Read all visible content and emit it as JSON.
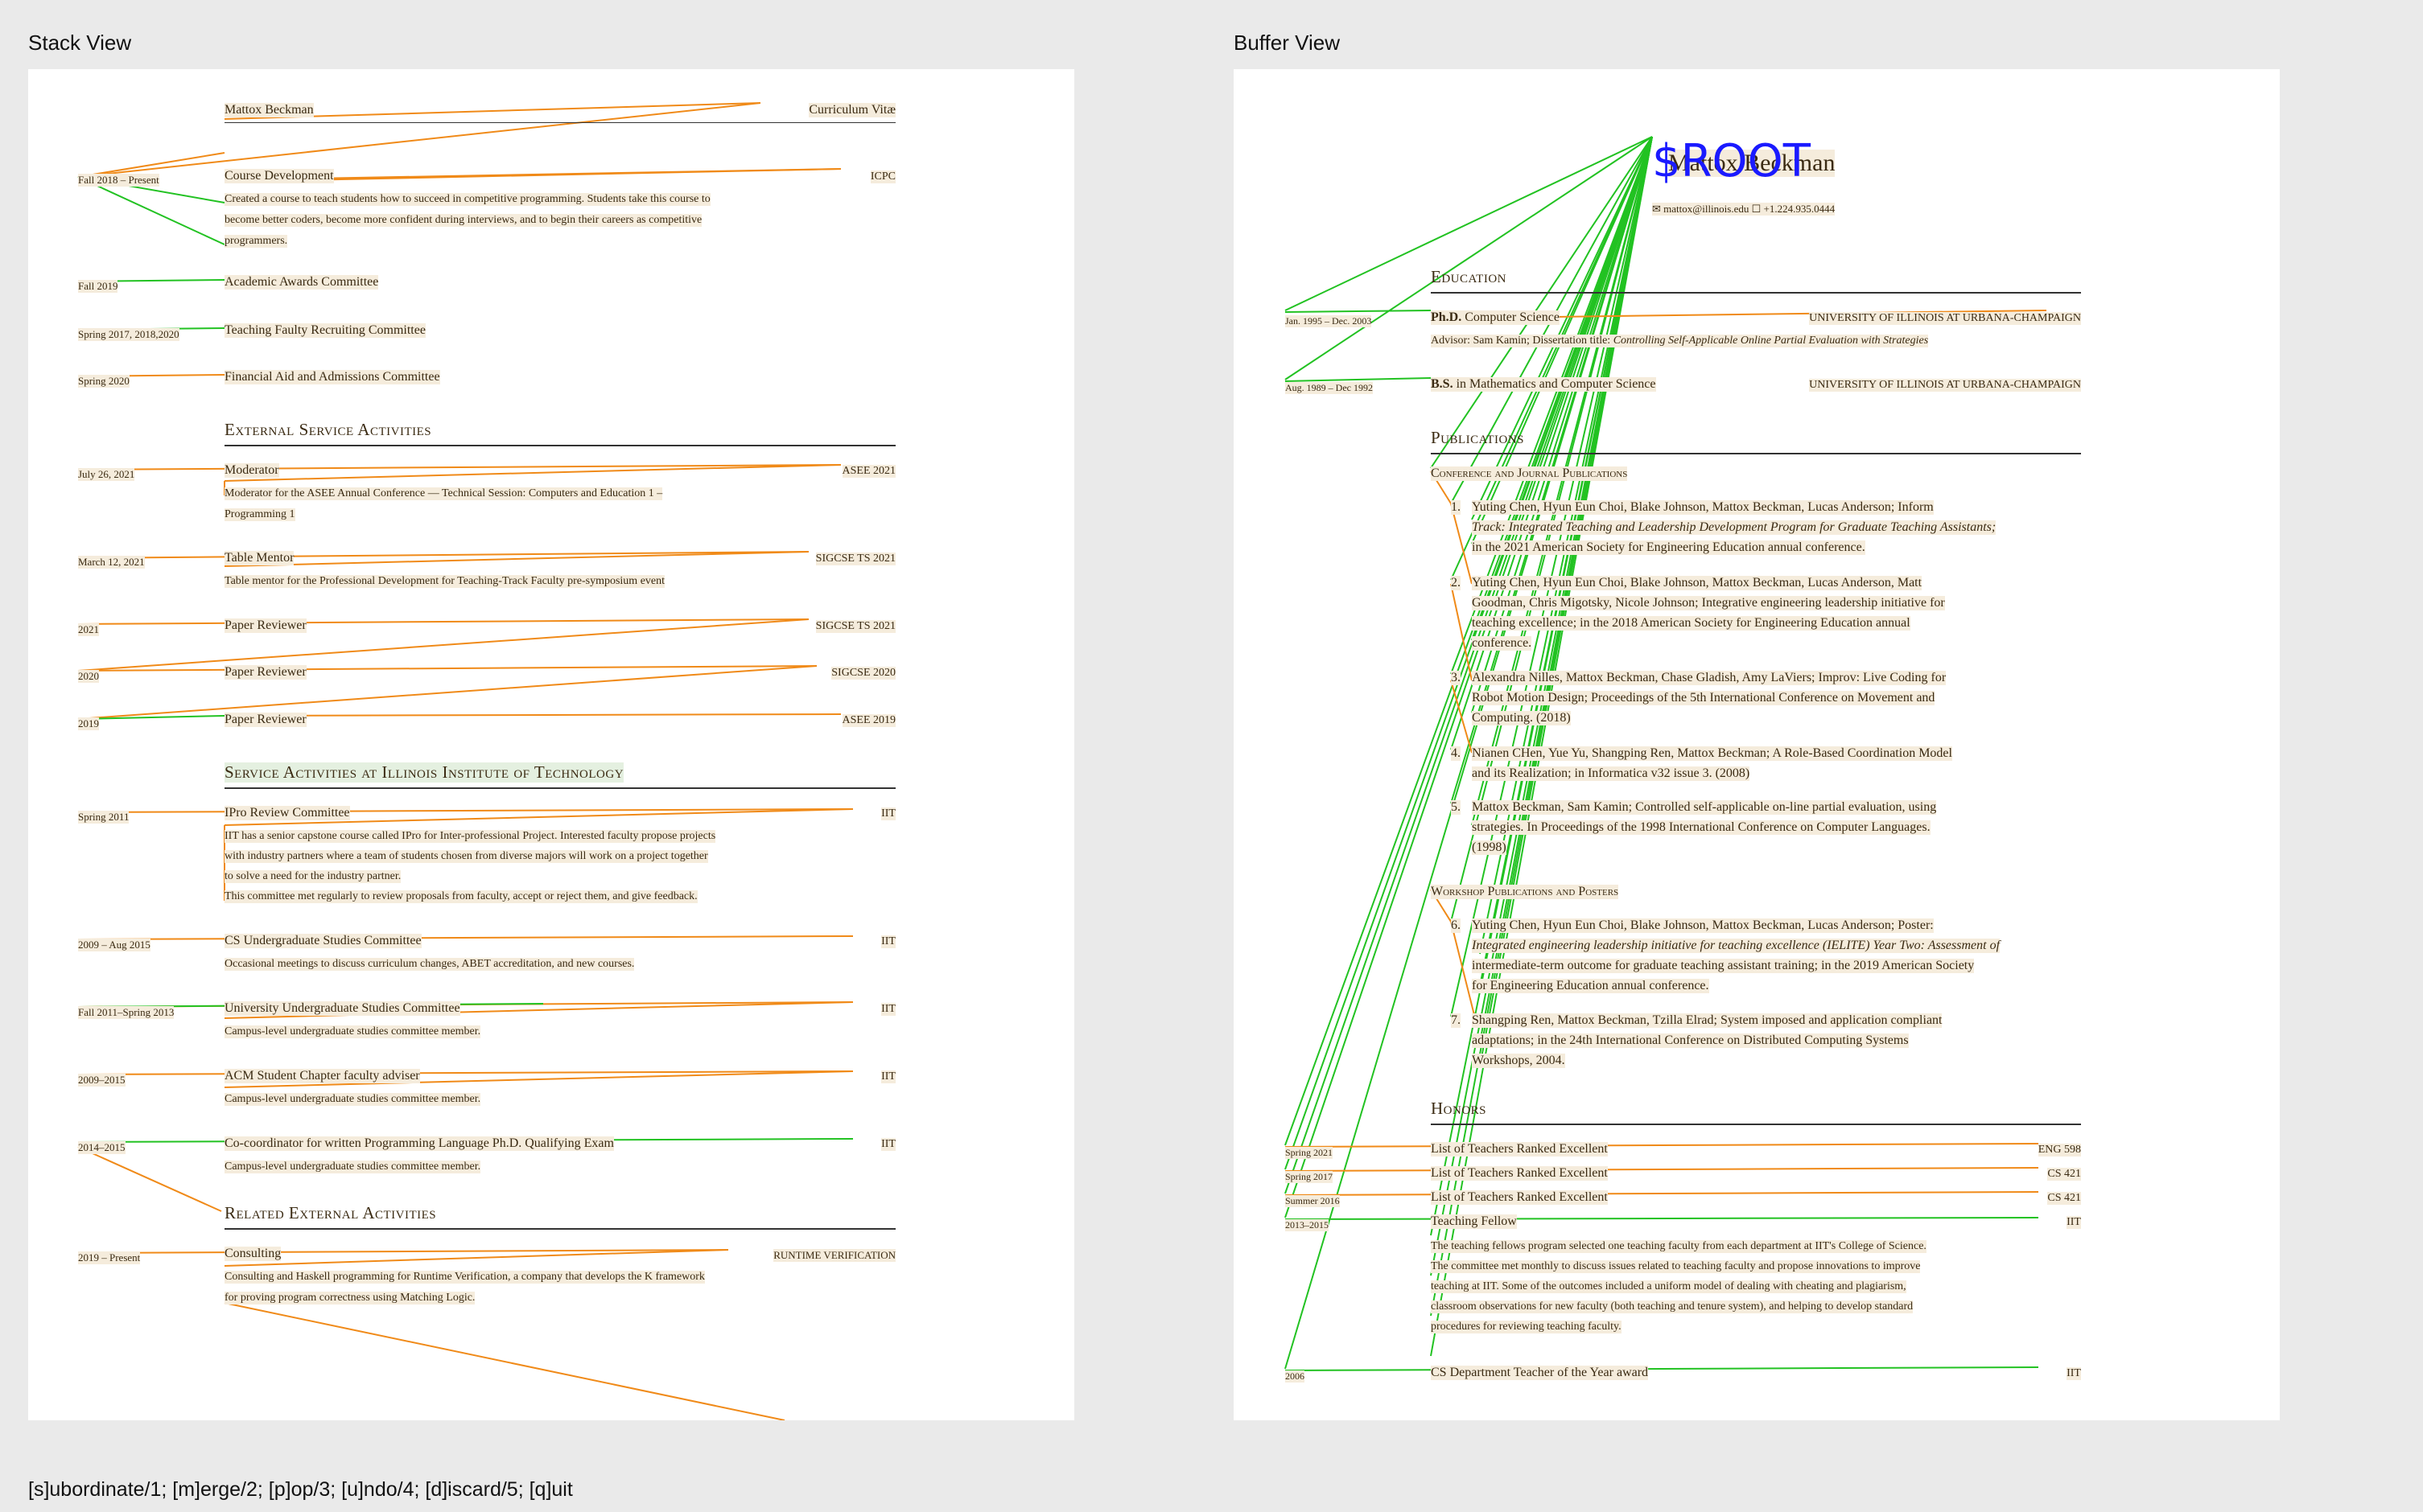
{
  "stack_view": {
    "title": "Stack View",
    "header_name": "Mattox Beckman",
    "header_right": "Curriculum Vitæ",
    "entries": [
      {
        "date": "Fall 2018 – Present",
        "title": "Course Development",
        "right": "ICPC",
        "desc": [
          "Created a course to teach students how to succeed in competitive programming. Students take this course to",
          "become better coders, become more confident during interviews, and to begin their careers as competitive",
          "programmers."
        ]
      },
      {
        "date": "Fall 2019",
        "title": "Academic Awards Committee",
        "right": "",
        "desc": []
      },
      {
        "date": "Spring 2017, 2018,2020",
        "title": "Teaching Faulty Recruiting Committee",
        "right": "",
        "desc": []
      },
      {
        "date": "Spring 2020",
        "title": "Financial Aid and Admissions Committee",
        "right": "",
        "desc": []
      }
    ],
    "section_external": "External Service Activities",
    "external": [
      {
        "date": "July 26, 2021",
        "title": "Moderator",
        "right": "ASEE 2021",
        "desc": [
          "Moderator for the ASEE Annual Conference — Technical Session: Computers and Education 1 –",
          "Programming 1"
        ]
      },
      {
        "date": "March 12, 2021",
        "title": "Table Mentor",
        "right": "SIGCSE TS 2021",
        "desc": [
          "Table mentor for the Professional Development for Teaching-Track Faculty pre-symposium event"
        ]
      },
      {
        "date": "2021",
        "title": "Paper Reviewer",
        "right": "SIGCSE TS 2021",
        "desc": []
      },
      {
        "date": "2020",
        "title": "Paper Reviewer",
        "right": "SIGCSE 2020",
        "desc": []
      },
      {
        "date": "2019",
        "title": "Paper Reviewer",
        "right": "ASEE 2019",
        "desc": []
      }
    ],
    "section_iit": "Service Activities at Illinois Institute of Technology",
    "iit": [
      {
        "date": "Spring 2011",
        "title": "IPro Review Committee",
        "right": "IIT",
        "desc": [
          "IIT has a senior capstone course called IPro for Inter-professional Project. Interested faculty propose projects",
          "with industry partners where a team of students chosen from diverse majors will work on a project together",
          "to solve a need for the industry partner.",
          "This committee met regularly to review proposals from faculty, accept or reject them, and give feedback."
        ]
      },
      {
        "date": "2009 – Aug 2015",
        "title": "CS Undergraduate Studies Committee",
        "right": "IIT",
        "desc": [
          "Occasional meetings to discuss curriculum changes, ABET accreditation, and new courses."
        ]
      },
      {
        "date": "Fall 2011–Spring 2013",
        "title": "University Undergraduate Studies Committee",
        "right": "IIT",
        "desc": [
          "Campus-level undergraduate studies committee member."
        ]
      },
      {
        "date": "2009–2015",
        "title": "ACM Student Chapter faculty adviser",
        "right": "IIT",
        "desc": [
          "Campus-level undergraduate studies committee member."
        ]
      },
      {
        "date": "2014–2015",
        "title": "Co-coordinator for written Programming Language Ph.D. Qualifying Exam",
        "right": "IIT",
        "desc": [
          "Campus-level undergraduate studies committee member."
        ]
      }
    ],
    "section_related": "Related External Activities",
    "related": [
      {
        "date": "2019 – Present",
        "title": "Consulting",
        "right": "RUNTIME VERIFICATION",
        "desc": [
          "Consulting and Haskell programming for Runtime Verification, a company that develops the K framework",
          "for proving program correctness using Matching Logic."
        ]
      }
    ]
  },
  "buffer_view": {
    "title": "Buffer View",
    "root_label": "$ROOT",
    "name": "Mattox Beckman",
    "contact": "✉ mattox@illinois.edu  ☐ +1.224.935.0444",
    "section_education": "Education",
    "education": [
      {
        "date": "Jan. 1995 – Dec. 2003",
        "degree": "Ph.D.",
        "field": " Computer Science",
        "school": "UNIVERSITY OF ILLINOIS AT URBANA-CHAMPAIGN",
        "advisor_prefix": "Advisor: Sam Kamin; Dissertation title: ",
        "advisor_title": "Controlling Self-Applicable Online Partial Evaluation with Strategies"
      },
      {
        "date": "Aug. 1989 – Dec 1992",
        "degree": "B.S.",
        "field": " in Mathematics and Computer Science",
        "school": "UNIVERSITY OF ILLINOIS AT URBANA-CHAMPAIGN",
        "advisor_prefix": "",
        "advisor_title": ""
      }
    ],
    "section_publications": "Publications",
    "sub_conference": "Conference and Journal Publications",
    "conference": [
      {
        "num": "1.",
        "lines": [
          "Yuting Chen, Hyun Eun Choi, Blake Johnson, Mattox Beckman, Lucas Anderson; Inform",
          "Track: Integrated Teaching and Leadership Development Program for Graduate Teaching Assistants;",
          "in the 2021 American Society for Engineering Education annual conference."
        ]
      },
      {
        "num": "2.",
        "lines": [
          "Yuting Chen, Hyun Eun Choi, Blake Johnson, Mattox Beckman, Lucas Anderson, Matt",
          "Goodman, Chris Migotsky, Nicole Johnson; Integrative engineering leadership initiative for",
          "teaching excellence; in the 2018 American Society for Engineering Education annual",
          "conference."
        ]
      },
      {
        "num": "3.",
        "lines": [
          "Alexandra Nilles, Mattox Beckman, Chase Gladish, Amy LaViers; Improv: Live Coding for",
          "Robot Motion Design; Proceedings of the 5th International Conference on Movement and",
          "Computing. (2018)"
        ]
      },
      {
        "num": "4.",
        "lines": [
          "Nianen CHen, Yue Yu, Shangping Ren, Mattox Beckman; A Role-Based Coordination Model",
          "and its Realization; in Informatica v32 issue 3. (2008)"
        ]
      },
      {
        "num": "5.",
        "lines": [
          "Mattox Beckman, Sam Kamin; Controlled self-applicable on-line partial evaluation, using",
          "strategies. In Proceedings of the 1998 International Conference on Computer Languages.",
          "(1998)"
        ]
      }
    ],
    "sub_workshop": "Workshop Publications and Posters",
    "workshop": [
      {
        "num": "6.",
        "lines": [
          "Yuting Chen, Hyun Eun Choi, Blake Johnson, Mattox Beckman, Lucas Anderson; Poster:",
          "Integrated engineering leadership initiative for teaching excellence (IELITE) Year Two: Assessment of",
          "intermediate-term outcome for graduate teaching assistant training; in the 2019 American Society",
          "for Engineering Education annual conference."
        ]
      },
      {
        "num": "7.",
        "lines": [
          "Shangping Ren, Mattox Beckman, Tzilla Elrad; System imposed and application compliant",
          "adaptations; in the 24th International Conference on Distributed Computing Systems",
          "Workshops, 2004."
        ]
      }
    ],
    "section_honors": "Honors",
    "honors": [
      {
        "date": "Spring 2021",
        "title": "List of Teachers Ranked Excellent",
        "right": "ENG 598"
      },
      {
        "date": "Spring 2017",
        "title": "List of Teachers Ranked Excellent",
        "right": "CS 421"
      },
      {
        "date": "Summer 2016",
        "title": "List of Teachers Ranked Excellent",
        "right": "CS 421"
      },
      {
        "date": "2013–2015",
        "title": "Teaching Fellow",
        "right": "IIT"
      }
    ],
    "fellow_desc": [
      "The teaching fellows program selected one teaching faculty from each department at IIT's College of Science.",
      "The committee met monthly to discuss issues related to teaching faculty and propose innovations to improve",
      "teaching at IIT. Some of the outcomes included a uniform model of dealing with cheating and plagiarism,",
      "classroom observations for new faculty (both teaching and tenure system), and helping to develop standard",
      "procedures for reviewing teaching faculty."
    ],
    "last_honor": {
      "date": "2006",
      "title": "CS Department Teacher of the Year award",
      "right": "IIT"
    }
  },
  "command_bar": "[s]ubordinate/1; [m]erge/2; [p]op/3; [u]ndo/4; [d]iscard/5; [q]uit",
  "colors": {
    "background": "#eaeaea",
    "panel": "#ffffff",
    "green_edge": "#22c222",
    "orange_edge": "#f08a18",
    "root": "#1a1aff",
    "highlight": "#f5ecdc"
  }
}
